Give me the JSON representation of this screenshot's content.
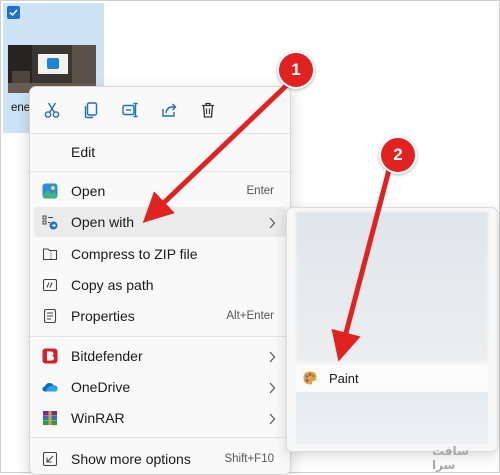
{
  "desktop": {
    "file_name": "ene",
    "file_selected": true
  },
  "context_menu": {
    "toolbar": [
      {
        "name": "cut-icon"
      },
      {
        "name": "copy-icon"
      },
      {
        "name": "rename-icon"
      },
      {
        "name": "share-icon"
      },
      {
        "name": "delete-icon"
      }
    ],
    "items": {
      "edit": {
        "label": "Edit"
      },
      "open": {
        "label": "Open",
        "shortcut": "Enter",
        "icon": "photos-icon"
      },
      "open_with": {
        "label": "Open with",
        "icon": "open-with-icon",
        "has_submenu": true,
        "highlighted": true
      },
      "compress": {
        "label": "Compress to ZIP file",
        "icon": "zip-icon"
      },
      "copy_path": {
        "label": "Copy as path",
        "icon": "copy-path-icon"
      },
      "properties": {
        "label": "Properties",
        "shortcut": "Alt+Enter",
        "icon": "properties-icon"
      },
      "bitdefender": {
        "label": "Bitdefender",
        "icon": "bitdefender-icon",
        "has_submenu": true
      },
      "onedrive": {
        "label": "OneDrive",
        "icon": "onedrive-icon",
        "has_submenu": true
      },
      "winrar": {
        "label": "WinRAR",
        "icon": "winrar-icon",
        "has_submenu": true
      },
      "more_options": {
        "label": "Show more options",
        "shortcut": "Shift+F10",
        "icon": "more-options-icon"
      }
    }
  },
  "submenu": {
    "paint": {
      "label": "Paint",
      "icon": "paint-icon"
    }
  },
  "annotations": {
    "step1": "1",
    "step2": "2",
    "color": "#e22121"
  },
  "watermark": {
    "text": "سافت سرا"
  },
  "colors": {
    "accent": "#1a73d9",
    "menu_bg": "#f9f9f9",
    "hover_bg": "#ebebeb",
    "annotation_red": "#e22121"
  }
}
